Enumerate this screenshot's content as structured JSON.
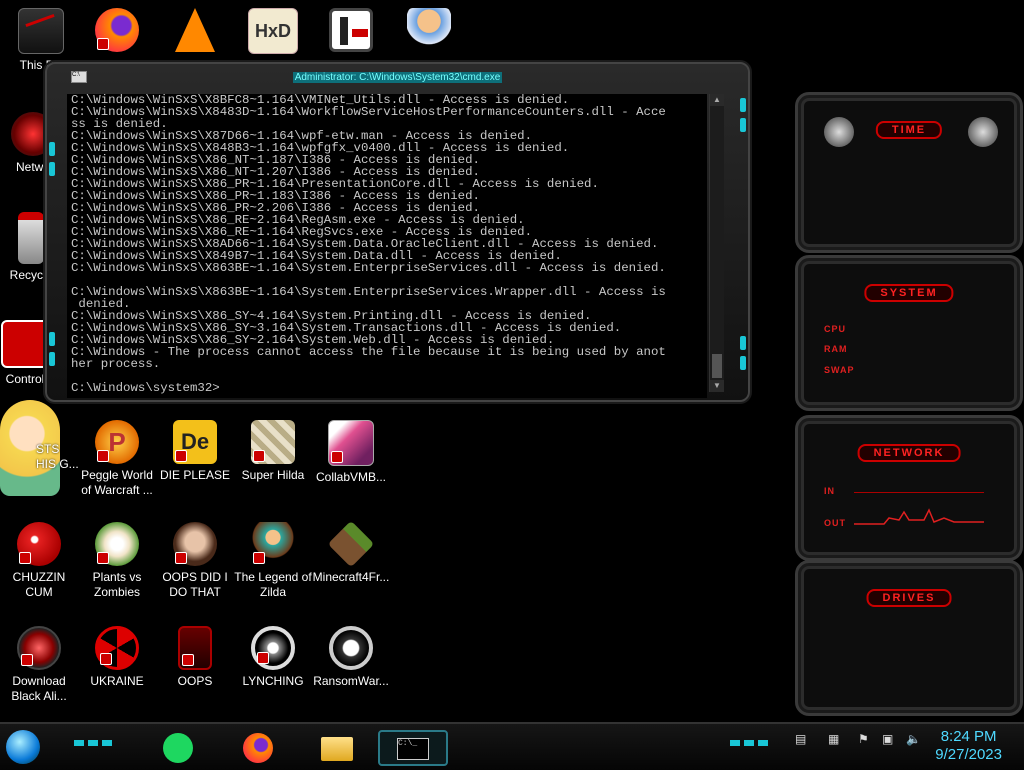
{
  "desktop": {
    "icons_top_row": [
      {
        "label": "This PC",
        "icon": "this-pc-icon"
      },
      {
        "label": "",
        "icon": "firefox-icon"
      },
      {
        "label": "",
        "icon": "vlc-icon"
      },
      {
        "label": "",
        "icon": "hxd-icon"
      },
      {
        "label": "",
        "icon": "app-maze-icon"
      },
      {
        "label": "",
        "icon": "doctor-icon"
      }
    ],
    "icons_left_column": [
      {
        "label": "Netwo",
        "icon": "network-icon"
      },
      {
        "label": "Recycle",
        "icon": "recycle-bin-icon"
      },
      {
        "label": "Control",
        "icon": "control-panel-icon"
      },
      {
        "label": "STS\nHIS G...",
        "icon": "star-butterfly-icon"
      }
    ],
    "icons_grid": [
      {
        "label": "Peggle World of Warcraft ...",
        "icon": "peggle-icon"
      },
      {
        "label": "DIE PLEASE",
        "icon": "die-please-icon"
      },
      {
        "label": "Super Hilda",
        "icon": "super-hilda-icon"
      },
      {
        "label": "CollabVMB...",
        "icon": "collabvm-icon"
      },
      {
        "label": "CHUZZIN CUM",
        "icon": "chuzzle-icon"
      },
      {
        "label": "Plants vs Zombies",
        "icon": "pvz-icon"
      },
      {
        "label": "OOPS DID I DO THAT",
        "icon": "portrait-icon"
      },
      {
        "label": "The Legend of Zilda",
        "icon": "zilda-icon"
      },
      {
        "label": "Minecraft4Fr...",
        "icon": "minecraft-icon"
      },
      {
        "label": "Download Black Ali...",
        "icon": "alienware-icon"
      },
      {
        "label": "UKRAINE",
        "icon": "radiation-icon"
      },
      {
        "label": "OOPS",
        "icon": "oops-icon"
      },
      {
        "label": "LYNCHING",
        "icon": "lynching-icon"
      },
      {
        "label": "RansomWar...",
        "icon": "skull-icon"
      }
    ]
  },
  "cmd": {
    "title": "Administrator: C:\\Windows\\System32\\cmd.exe",
    "lines": [
      "C:\\Windows\\WinSxS\\X8BFC8~1.164\\VMINet_Utils.dll - Access is denied.",
      "C:\\Windows\\WinSxS\\X8483D~1.164\\WorkflowServiceHostPerformanceCounters.dll - Acce",
      "ss is denied.",
      "C:\\Windows\\WinSxS\\X87D66~1.164\\wpf-etw.man - Access is denied.",
      "C:\\Windows\\WinSxS\\X848B3~1.164\\wpfgfx_v0400.dll - Access is denied.",
      "C:\\Windows\\WinSxS\\X86_NT~1.187\\I386 - Access is denied.",
      "C:\\Windows\\WinSxS\\X86_NT~1.207\\I386 - Access is denied.",
      "C:\\Windows\\WinSxS\\X86_PR~1.164\\PresentationCore.dll - Access is denied.",
      "C:\\Windows\\WinSxS\\X86_PR~1.183\\I386 - Access is denied.",
      "C:\\Windows\\WinSxS\\X86_PR~2.206\\I386 - Access is denied.",
      "C:\\Windows\\WinSxS\\X86_RE~2.164\\RegAsm.exe - Access is denied.",
      "C:\\Windows\\WinSxS\\X86_RE~1.164\\RegSvcs.exe - Access is denied.",
      "C:\\Windows\\WinSxS\\X8AD66~1.164\\System.Data.OracleClient.dll - Access is denied.",
      "C:\\Windows\\WinSxS\\X849B7~1.164\\System.Data.dll - Access is denied.",
      "C:\\Windows\\WinSxS\\X863BE~1.164\\System.EnterpriseServices.dll - Access is denied.",
      "",
      "C:\\Windows\\WinSxS\\X863BE~1.164\\System.EnterpriseServices.Wrapper.dll - Access is",
      " denied.",
      "C:\\Windows\\WinSxS\\X86_SY~4.164\\System.Printing.dll - Access is denied.",
      "C:\\Windows\\WinSxS\\X86_SY~3.164\\System.Transactions.dll - Access is denied.",
      "C:\\Windows\\WinSxS\\X86_SY~2.164\\System.Web.dll - Access is denied.",
      "C:\\Windows - The process cannot access the file because it is being used by anot",
      "her process.",
      "",
      "C:\\Windows\\system32>"
    ]
  },
  "gadgets": {
    "time": {
      "title": "TIME"
    },
    "system": {
      "title": "SYSTEM",
      "labels": [
        "CPU",
        "RAM",
        "SWAP"
      ]
    },
    "network": {
      "title": "NETWORK",
      "labels": [
        "IN",
        "OUT"
      ]
    },
    "drives": {
      "title": "DRIVES"
    }
  },
  "taskbar": {
    "pinned": [
      "start-orb-icon",
      "spotify-icon",
      "firefox-icon",
      "file-explorer-icon",
      "cmd-icon"
    ],
    "tray_icons": [
      "show-desktop-icon",
      "network-adapter-icon",
      "flag-icon",
      "action-center-icon",
      "volume-icon"
    ],
    "clock": {
      "time": "8:24 PM",
      "date": "9/27/2023"
    }
  },
  "colors": {
    "accent_teal": "#19c6d6",
    "accent_red": "#e02020",
    "clock_blue": "#4fd9ff"
  }
}
